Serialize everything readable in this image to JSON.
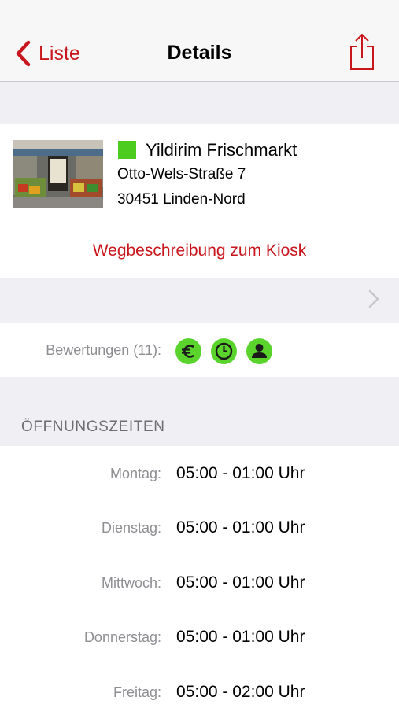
{
  "navbar": {
    "back_label": "Liste",
    "title": "Details",
    "share_icon": "share-icon",
    "accent_color": "#c9161c"
  },
  "store": {
    "name": "Yildirim Frischmarkt",
    "street": "Otto-Wels-Straße 7",
    "city": "30451 Linden-Nord",
    "status_color": "#4ccc1e",
    "directions_label": "Wegbeschreibung zum Kiosk"
  },
  "ratings": {
    "label": "Bewertungen (11):",
    "badges": [
      "euro-icon",
      "clock-icon",
      "person-icon"
    ],
    "badge_color": "#5ad42c"
  },
  "hours": {
    "header": "ÖFFNUNGSZEITEN",
    "rows": [
      {
        "day": "Montag:",
        "time": "05:00 - 01:00 Uhr"
      },
      {
        "day": "Dienstag:",
        "time": "05:00 - 01:00 Uhr"
      },
      {
        "day": "Mittwoch:",
        "time": "05:00 - 01:00 Uhr"
      },
      {
        "day": "Donnerstag:",
        "time": "05:00 - 01:00 Uhr"
      },
      {
        "day": "Freitag:",
        "time": "05:00 - 02:00 Uhr"
      }
    ]
  }
}
